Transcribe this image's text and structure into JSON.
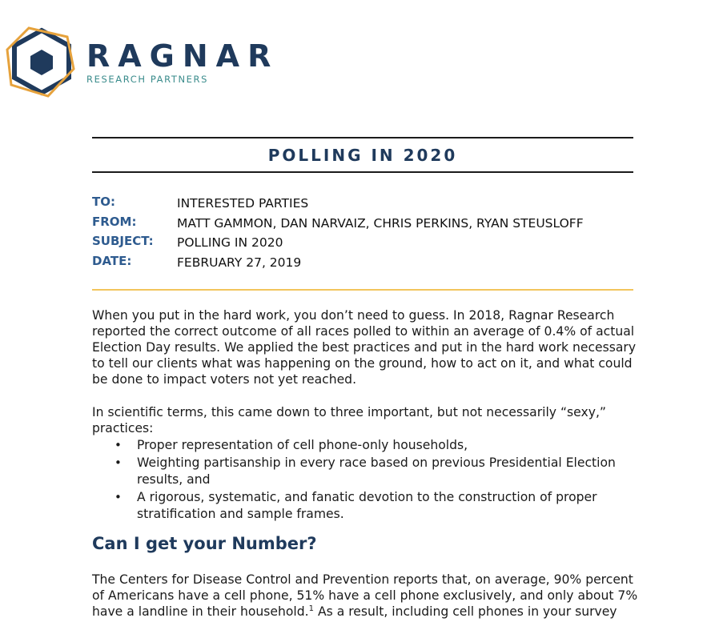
{
  "brand": {
    "name": "RAGNAR",
    "subtitle": "RESEARCH PARTNERS",
    "colors": {
      "navy": "#1f3a5c",
      "gold": "#e6a23c",
      "teal": "#3b8c8c"
    }
  },
  "memo": {
    "title": "POLLING IN 2020",
    "to_label": "TO:",
    "to_value": "INTERESTED PARTIES",
    "from_label": "FROM:",
    "from_value": "MATT GAMMON, DAN NARVAIZ, CHRIS PERKINS, RYAN STEUSLOFF",
    "subject_label": "SUBJECT:",
    "subject_value": "POLLING IN 2020",
    "date_label": "DATE:",
    "date_value": "FEBRUARY 27, 2019"
  },
  "body": {
    "p1": [
      "When you put in the hard work, you don’t need to guess. In 2018, Ragnar Research",
      "reported the correct outcome of all races polled to within an average of 0.4% of actual",
      "Election Day results. We applied the best practices and put in the hard work necessary",
      "to tell our clients what was happening on the ground, how to act on it, and what could",
      "be done to impact voters not yet reached."
    ],
    "p2": [
      "In scientific terms, this came down to three important, but not necessarily “sexy,”",
      "practices:"
    ],
    "bullets": [
      [
        "Proper representation of cell phone-only households,"
      ],
      [
        "Weighting partisanship in every race based on previous Presidential Election",
        "results, and"
      ],
      [
        "A rigorous, systematic, and fanatic devotion to the construction of proper",
        "stratification and sample frames."
      ]
    ],
    "heading": "Can I get your Number?",
    "p3_l1": "The Centers for Disease Control and Prevention reports that, on average, 90% percent",
    "p3_l2": "of Americans have a cell phone, 51% have a cell phone exclusively, and only about 7%",
    "p3_l3a": "have a landline in their household.",
    "p3_l3_sup": "1",
    "p3_l3b": " As a result, including cell phones in your survey"
  }
}
